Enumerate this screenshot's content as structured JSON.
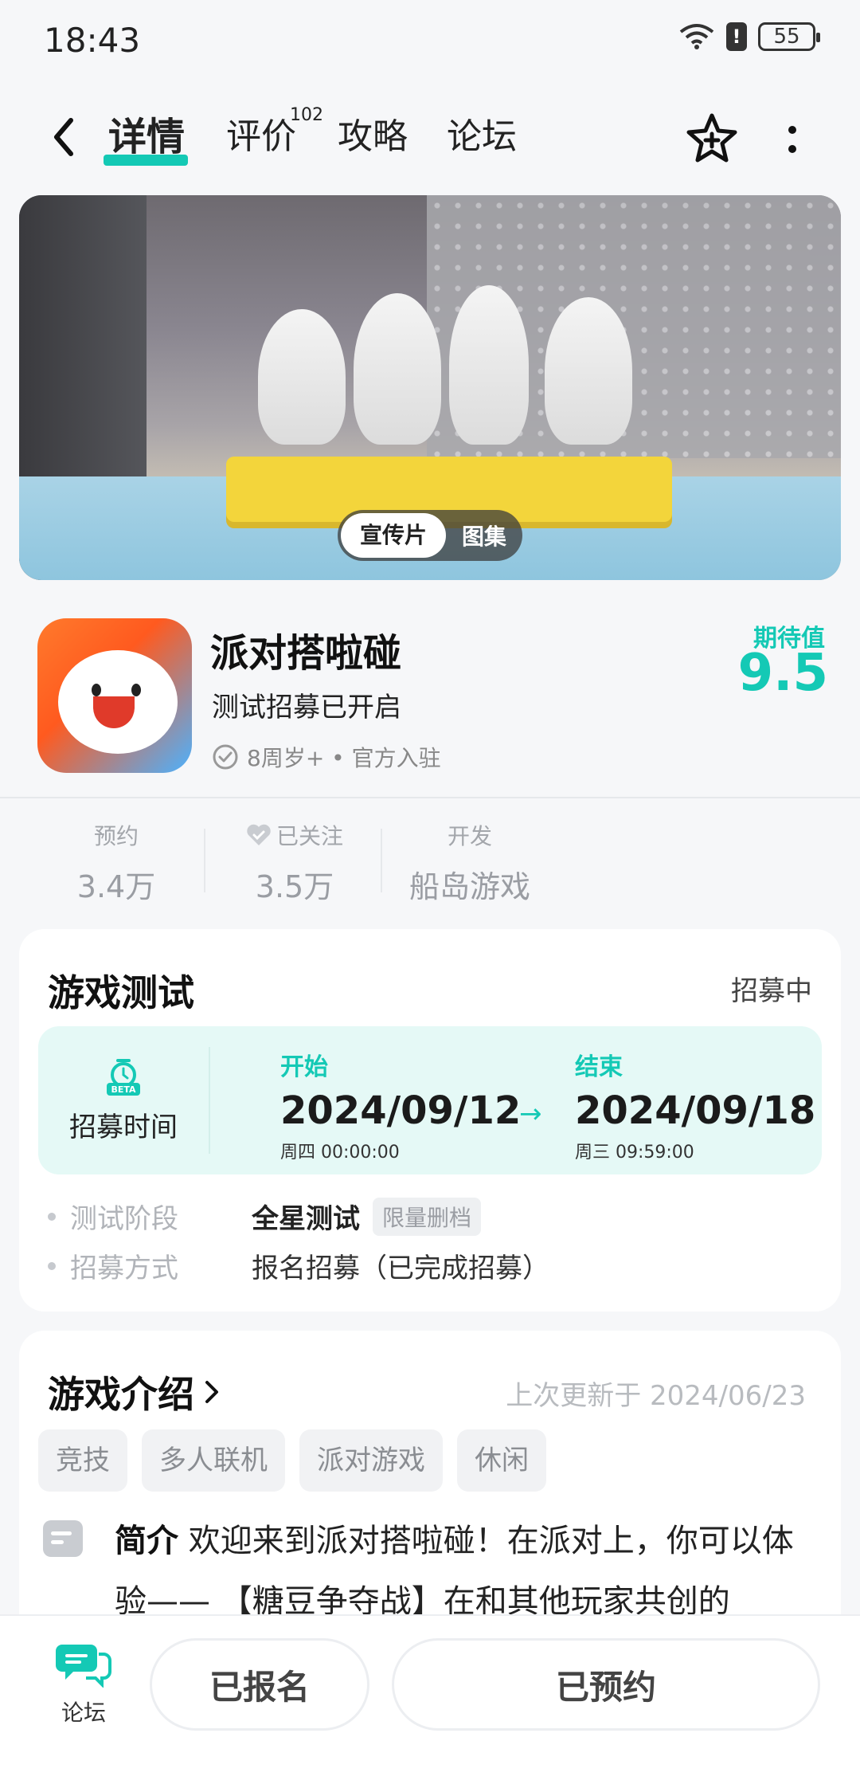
{
  "status_bar": {
    "time": "18:43",
    "battery": "55",
    "alert": "!"
  },
  "nav": {
    "tabs": [
      "详情",
      "评价",
      "攻略",
      "论坛"
    ],
    "review_badge": "102"
  },
  "banner": {
    "toggle_active": "宣传片",
    "toggle_inactive": "图集"
  },
  "game": {
    "title": "派对搭啦碰",
    "subtitle": "测试招募已开启",
    "meta": "8周岁+ • 官方入驻",
    "expect_label": "期待值",
    "expect_value": "9.5"
  },
  "stats": [
    {
      "label": "预约",
      "value": "3.4万"
    },
    {
      "label": "已关注",
      "value": "3.5万"
    },
    {
      "label": "开发",
      "value": "船岛游戏"
    }
  ],
  "test": {
    "title": "游戏测试",
    "status": "招募中",
    "time_label": "招募时间",
    "beta": "BETA",
    "start_label": "开始",
    "start_date": "2024/09/12",
    "start_sub": "周四  00:00:00",
    "end_label": "结束",
    "end_date": "2024/09/18",
    "end_sub": "周三  09:59:00",
    "stage_key": "测试阶段",
    "stage_value": "全星测试",
    "stage_tag": "限量删档",
    "method_key": "招募方式",
    "method_value": "报名招募（已完成招募）"
  },
  "intro": {
    "title": "游戏介绍",
    "updated": "上次更新于 2024/06/23",
    "tags": [
      "竞技",
      "多人联机",
      "派对游戏",
      "休闲"
    ],
    "summary_label": "简介",
    "summary_text": " 欢迎来到派对搭啦碰！在派对上，你可以体验—— 【糖豆争夺战】在和其他玩家共创的"
  },
  "bottom": {
    "forum_label": "论坛",
    "registered_label": "已报名",
    "reserved_label": "已预约"
  },
  "colors": {
    "accent": "#14c9b5",
    "background": "#f6f7f9"
  }
}
